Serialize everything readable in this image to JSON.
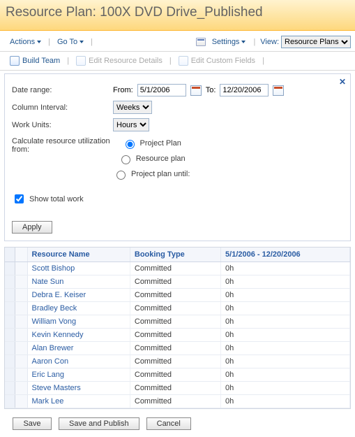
{
  "title": "Resource Plan: 100X DVD Drive_Published",
  "menu": {
    "actions": "Actions",
    "goto": "Go To",
    "settings": "Settings",
    "view_label": "View:",
    "view_value": "Resource Plans"
  },
  "toolbar": {
    "build_team": "Build Team",
    "edit_resource_details": "Edit Resource Details",
    "edit_custom_fields": "Edit Custom Fields"
  },
  "form": {
    "date_range_label": "Date range:",
    "from_label": "From:",
    "from_value": "5/1/2006",
    "to_label": "To:",
    "to_value": "12/20/2006",
    "column_interval_label": "Column Interval:",
    "column_interval_value": "Weeks",
    "work_units_label": "Work Units:",
    "work_units_value": "Hours",
    "calc_label": "Calculate resource utilization from:",
    "radio_project_plan": "Project Plan",
    "radio_resource_plan": "Resource plan",
    "radio_project_plan_until": "Project plan until:",
    "show_total_work": "Show total work",
    "apply": "Apply"
  },
  "grid": {
    "headers": {
      "resource_name": "Resource Name",
      "booking_type": "Booking Type",
      "date_range": "5/1/2006 - 12/20/2006"
    },
    "rows": [
      {
        "name": "Scott Bishop",
        "booking": "Committed",
        "hours": "0h"
      },
      {
        "name": "Nate Sun",
        "booking": "Committed",
        "hours": "0h"
      },
      {
        "name": "Debra E. Keiser",
        "booking": "Committed",
        "hours": "0h"
      },
      {
        "name": "Bradley Beck",
        "booking": "Committed",
        "hours": "0h"
      },
      {
        "name": "William Vong",
        "booking": "Committed",
        "hours": "0h"
      },
      {
        "name": "Kevin Kennedy",
        "booking": "Committed",
        "hours": "0h"
      },
      {
        "name": "Alan Brewer",
        "booking": "Committed",
        "hours": "0h"
      },
      {
        "name": "Aaron Con",
        "booking": "Committed",
        "hours": "0h"
      },
      {
        "name": "Eric Lang",
        "booking": "Committed",
        "hours": "0h"
      },
      {
        "name": "Steve Masters",
        "booking": "Committed",
        "hours": "0h"
      },
      {
        "name": "Mark Lee",
        "booking": "Committed",
        "hours": "0h"
      }
    ]
  },
  "footer": {
    "save": "Save",
    "save_and_publish": "Save and Publish",
    "cancel": "Cancel"
  }
}
